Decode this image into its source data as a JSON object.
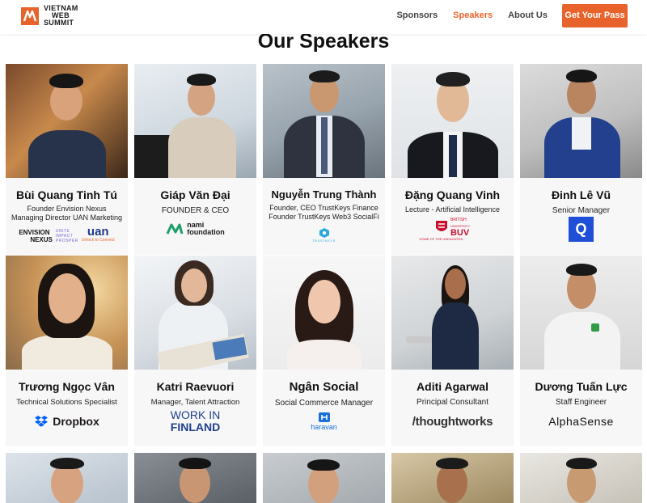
{
  "brand": {
    "line1": "VIETNAM",
    "line2": "WEB",
    "line3": "SUMMIT"
  },
  "nav": {
    "items": [
      {
        "label": "Sponsors",
        "active": false
      },
      {
        "label": "Speakers",
        "active": true
      },
      {
        "label": "About Us",
        "active": false
      }
    ],
    "cta": "Get Your Pass"
  },
  "page": {
    "title": "Our Speakers"
  },
  "colors": {
    "accent": "#e8632b"
  },
  "speakers": [
    {
      "name": "Bùi Quang Tinh Tú",
      "role_line1": "Founder Envision Nexus",
      "role_line2": "Managing Director UAN Marketing",
      "company": "ENVISION NEXUS / UNITE IMPACT PROSPER / uan",
      "company_a": "ENVISION",
      "company_b": "NEXUS",
      "company_c": "UNITE",
      "company_d": "IMPACT",
      "company_e": "PROSPER",
      "company_f": "uan",
      "company_g": "Unlock to Connect"
    },
    {
      "name": "Giáp Văn Đại",
      "role_line1": "FOUNDER & CEO",
      "company_a": "nami",
      "company_b": "foundation"
    },
    {
      "name": "Nguyễn Trung Thành",
      "role_line1": "Founder, CEO TrustKeys Finance",
      "role_line2": "Founder TrustKeys Web3 SocialFi",
      "company_a": "TRUSTKEYS"
    },
    {
      "name": "Đặng Quang Vinh",
      "role_line1": "Lecture - Artificial Intelligence",
      "company_a": "BRITISH",
      "company_b": "UNIVERSITY",
      "company_c": "BUV",
      "company_d": "HOME OF THE UNDAUNTED"
    },
    {
      "name": "Đinh Lê Vũ",
      "role_line1": "Senior Manager",
      "company_a": "Q"
    },
    {
      "name": "Trương Ngọc Vân",
      "role_line1": "Technical Solutions Specialist",
      "company_a": "Dropbox"
    },
    {
      "name": "Katri Raevuori",
      "role_line1": "Manager, Talent Attraction",
      "company_a": "WORK IN",
      "company_b": "FINLAND"
    },
    {
      "name": "Ngân Social",
      "role_line1": "Social Commerce Manager",
      "company_a": "haravan"
    },
    {
      "name": "Aditi Agarwal",
      "role_line1": "Principal Consultant",
      "company_a": "/thoughtworks"
    },
    {
      "name": "Dương Tuấn Lực",
      "role_line1": "Staff Engineer",
      "company_a": "AlphaSense"
    }
  ]
}
